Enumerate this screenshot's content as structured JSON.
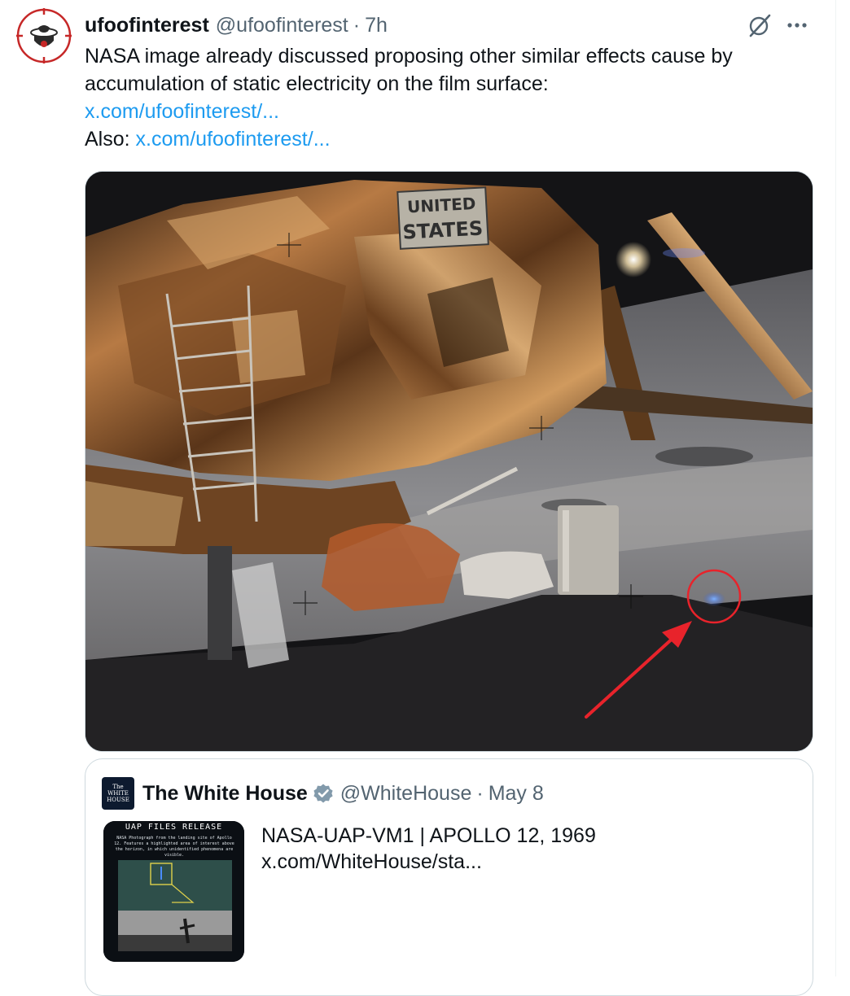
{
  "tweet": {
    "display_name": "ufoofinterest",
    "handle": "@ufoofinterest",
    "separator": "·",
    "time": "7h",
    "text_line": "NASA image already discussed proposing other similar effects cause by accumulation of static electricity on the film surface:",
    "link1": "x.com/ufoofinterest/...",
    "also_label": "Also:",
    "link2": "x.com/ufoofinterest/..."
  },
  "media": {
    "icons": [
      "lunar-module",
      "red-circle-highlight",
      "red-arrow-annotation"
    ],
    "sign_line1": "UNITED",
    "sign_line2": "STATES",
    "annotation_color": "#e8232b"
  },
  "quote": {
    "display_name": "The White House",
    "handle": "@WhiteHouse",
    "separator": "·",
    "date": "May 8",
    "avatar_line1": "The",
    "avatar_line2": "WHITE",
    "avatar_line3": "HOUSE",
    "text": "NASA-UAP-VM1 | APOLLO 12, 1969  x.com/WhiteHouse/sta...",
    "thumb_title": "UAP FILES RELEASE",
    "thumb_caption": "NASA Photograph from the landing site of Apollo 12. Features a highlighted area of interest above the horizon, in which unidentified phenomena are visible."
  },
  "colors": {
    "link": "#1d9bf0",
    "secondary_text": "#536471",
    "verified": "#829aab"
  }
}
